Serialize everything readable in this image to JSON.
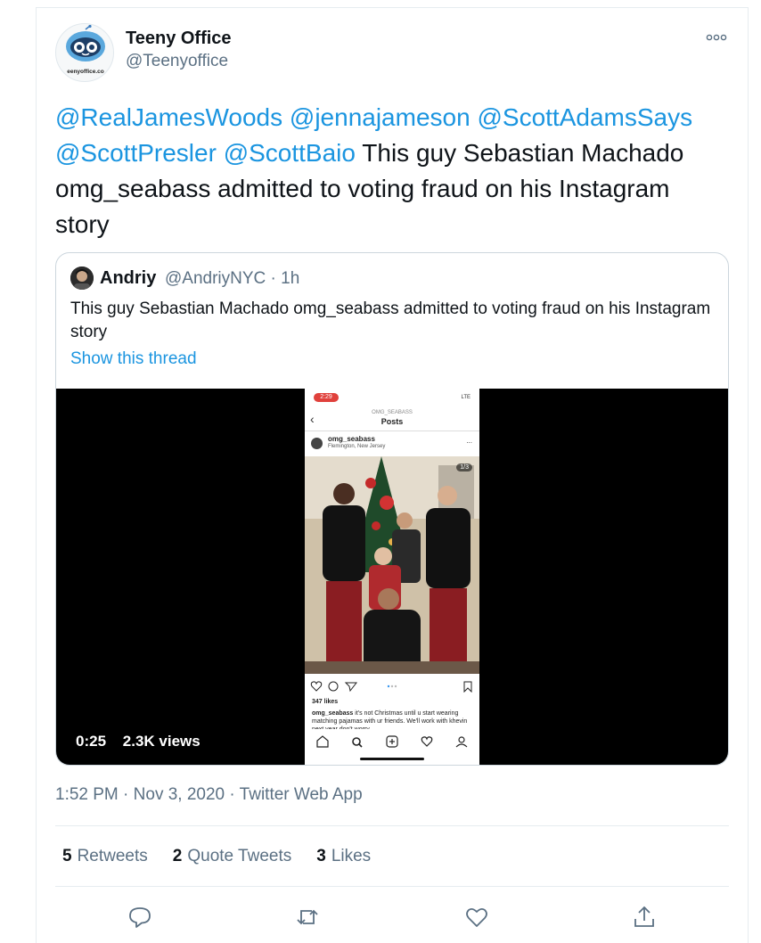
{
  "tweet": {
    "author_name": "Teeny Office",
    "author_handle": "@Teenyoffice",
    "avatar_text": "eenyoffice.co",
    "mentions": [
      "@RealJamesWoods",
      "@jennajameson",
      "@ScottAdamsSays",
      "@ScottPresler",
      "@ScottBaio"
    ],
    "text_after_mentions": "This guy Sebastian Machado omg_seabass admitted to voting fraud on his Instagram story",
    "time": "1:52 PM",
    "date": "Nov 3, 2020",
    "source": "Twitter Web App",
    "sep": " · "
  },
  "quote": {
    "author_name": "Andriy",
    "author_handle": "@AndriyNYC",
    "age": "1h",
    "text": "This guy Sebastian Machado omg_seabass admitted to voting fraud on his Instagram story",
    "show_thread": "Show this thread",
    "video": {
      "duration": "0:25",
      "views": "2.3K views"
    },
    "phone": {
      "status_time": "2:29",
      "signal": "LTE",
      "profile_top": "OMG_SEABASS",
      "posts_title": "Posts",
      "username": "omg_seabass",
      "location": "Flemington, New Jersey",
      "more": "...",
      "badge": "1/3",
      "likes": "347 likes",
      "caption_user": "omg_seabass",
      "caption": "it's not Christmas until u start wearing matching pajamas with ur friends. We'll work with khevin next year don't worry"
    }
  },
  "stats": {
    "retweets_count": "5",
    "retweets_label": "Retweets",
    "quotes_count": "2",
    "quotes_label": "Quote Tweets",
    "likes_count": "3",
    "likes_label": "Likes"
  },
  "colors": {
    "link": "#1b95e0",
    "secondary": "#5b7083",
    "border": "#e6ecf0"
  },
  "icons": [
    "more-icon",
    "reply-icon",
    "retweet-icon",
    "like-icon",
    "share-icon"
  ]
}
